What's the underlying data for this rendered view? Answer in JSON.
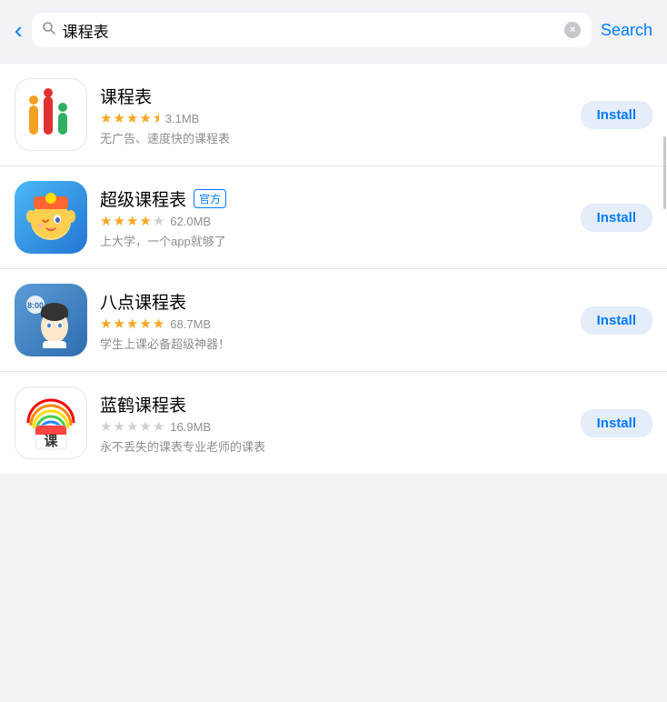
{
  "header": {
    "back_label": "‹",
    "search_value": "课程表",
    "clear_icon": "×",
    "search_label": "Search"
  },
  "apps": [
    {
      "id": "kechengbiao",
      "name": "课程表",
      "official": false,
      "stars": [
        1,
        1,
        1,
        1,
        0.5
      ],
      "rating_text": "3.1MB",
      "desc": "无广告、速度快的课程表",
      "install_label": "Install"
    },
    {
      "id": "super",
      "name": "超级课程表",
      "official": true,
      "official_text": "官方",
      "stars": [
        1,
        1,
        1,
        1,
        0
      ],
      "rating_text": "62.0MB",
      "desc": "上大学，一个app就够了",
      "install_label": "Install"
    },
    {
      "id": "badian",
      "name": "八点课程表",
      "official": false,
      "stars": [
        1,
        1,
        1,
        1,
        1
      ],
      "rating_text": "68.7MB",
      "desc": "学生上课必备超级神器！",
      "install_label": "Install"
    },
    {
      "id": "lanhe",
      "name": "蓝鹤课程表",
      "official": false,
      "stars": [
        0,
        0,
        0,
        0,
        0
      ],
      "rating_text": "16.9MB",
      "desc": "永不丢失的课表专业老师的课表",
      "install_label": "Install"
    }
  ]
}
